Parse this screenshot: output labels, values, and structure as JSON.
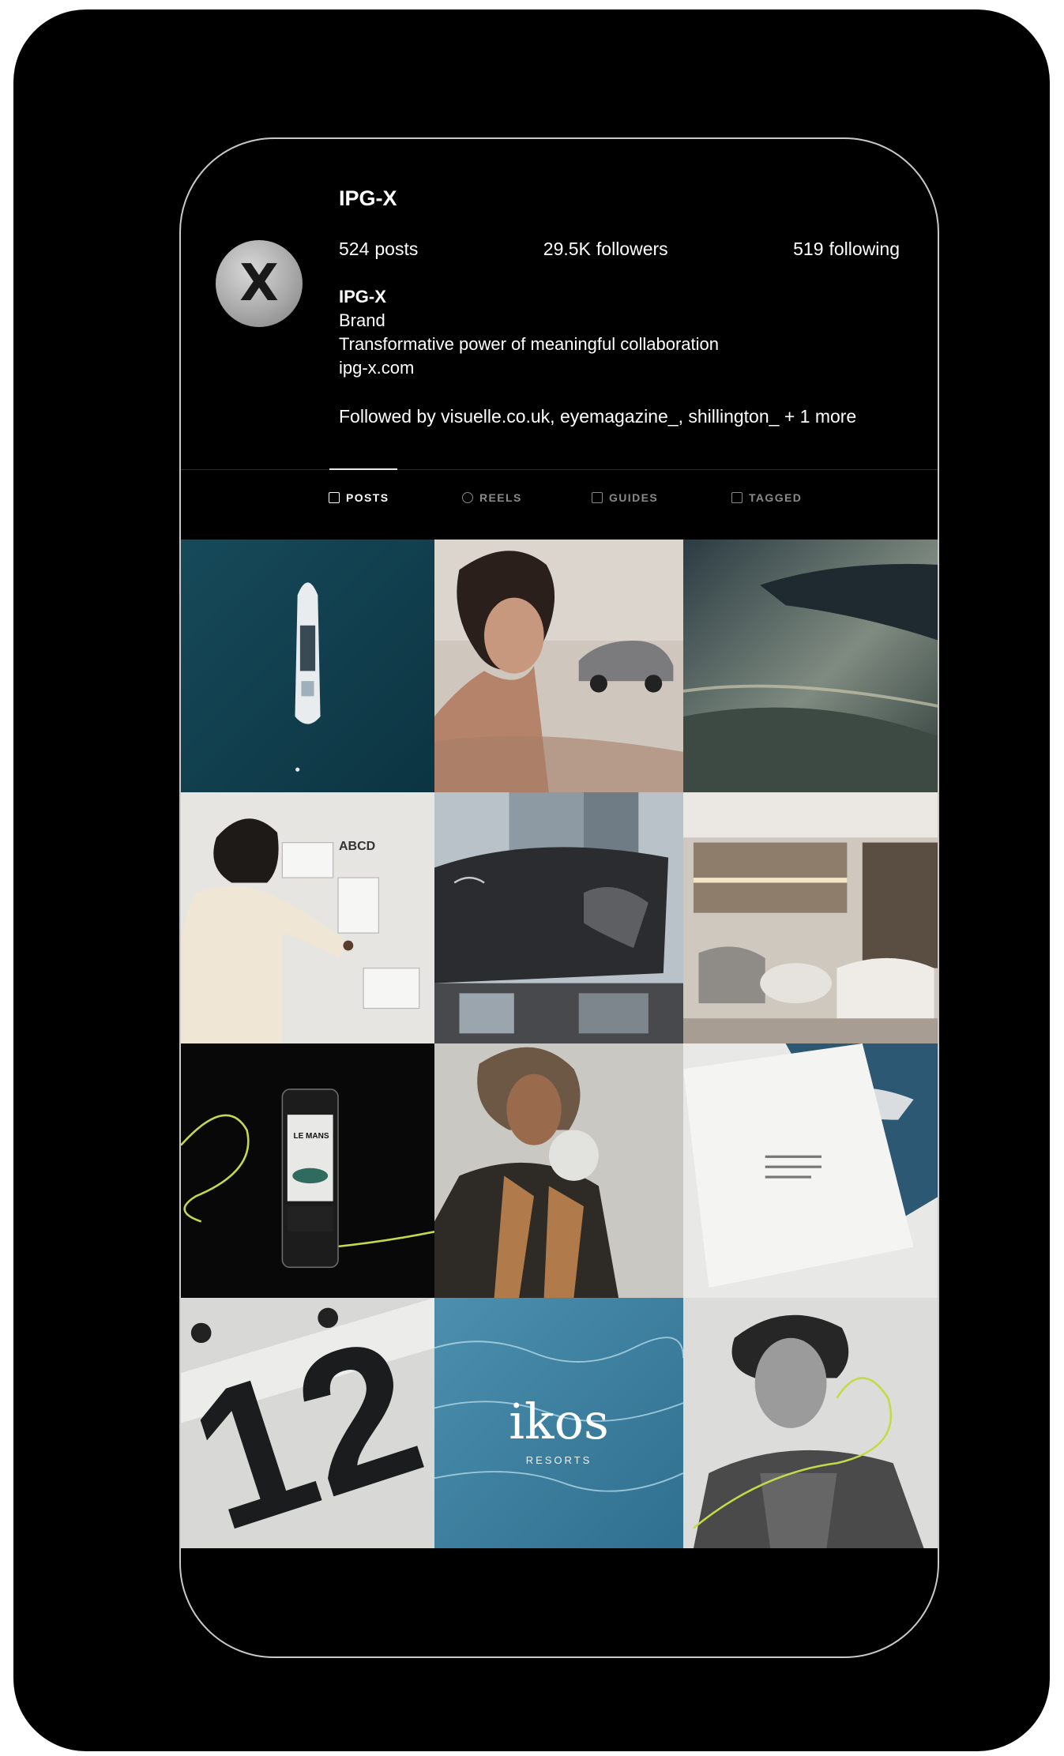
{
  "profile": {
    "username": "IPG-X",
    "avatar_letter": "X",
    "stats": {
      "posts_count": "524",
      "posts_label": "posts",
      "followers_count": "29.5K",
      "followers_label": "followers",
      "following_count": "519",
      "following_label": "following"
    },
    "bio": {
      "name": "IPG-X",
      "category": "Brand",
      "description": "Transformative power of meaningful collaboration",
      "link": "ipg-x.com"
    },
    "followed_by": "Followed by visuelle.co.uk, eyemagazine_, shillington_ + 1 more"
  },
  "tabs": [
    {
      "label": "POSTS",
      "icon": "grid-icon",
      "active": true
    },
    {
      "label": "REELS",
      "icon": "reels-icon",
      "active": false
    },
    {
      "label": "GUIDES",
      "icon": "guides-icon",
      "active": false
    },
    {
      "label": "TAGGED",
      "icon": "tagged-icon",
      "active": false
    }
  ],
  "posts": [
    {
      "subject": "yacht-aerial"
    },
    {
      "subject": "woman-with-car"
    },
    {
      "subject": "car-detail"
    },
    {
      "subject": "man-at-whiteboard",
      "text": "ABCD"
    },
    {
      "subject": "bentley-building"
    },
    {
      "subject": "showroom-interior"
    },
    {
      "subject": "phone-le-mans",
      "text": "LE MANS"
    },
    {
      "subject": "woman-portrait"
    },
    {
      "subject": "yacht-brochure"
    },
    {
      "subject": "number-print",
      "text": "12"
    },
    {
      "subject": "ikos-resorts",
      "text": "ikos",
      "subtext": "RESORTS"
    },
    {
      "subject": "smiling-man"
    }
  ],
  "colors": {
    "background": "#000000",
    "text": "#ffffff",
    "tab_inactive": "#8a8a8a",
    "accent_line": "#c6d94a"
  }
}
